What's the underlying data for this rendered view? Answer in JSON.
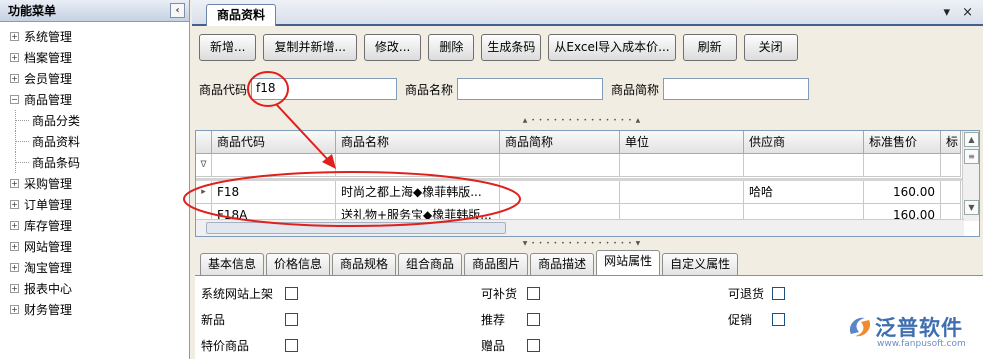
{
  "sidebar": {
    "title": "功能菜单",
    "collapse_icon": "chevron-left-icon",
    "items": [
      {
        "label": "系统管理",
        "expander": "+"
      },
      {
        "label": "档案管理",
        "expander": "+"
      },
      {
        "label": "会员管理",
        "expander": "+"
      },
      {
        "label": "商品管理",
        "expander": "−"
      },
      {
        "label": "采购管理",
        "expander": "+"
      },
      {
        "label": "订单管理",
        "expander": "+"
      },
      {
        "label": "库存管理",
        "expander": "+"
      },
      {
        "label": "网站管理",
        "expander": "+"
      },
      {
        "label": "淘宝管理",
        "expander": "+"
      },
      {
        "label": "报表中心",
        "expander": "+"
      },
      {
        "label": "财务管理",
        "expander": "+"
      }
    ],
    "children": [
      {
        "label": "商品分类"
      },
      {
        "label": "商品资料"
      },
      {
        "label": "商品条码"
      }
    ]
  },
  "tabbar": {
    "active_tab": "商品资料",
    "controls": "▾ ×"
  },
  "toolbar": {
    "new": "新增...",
    "copy_new": "复制并新增...",
    "edit": "修改...",
    "delete": "删除",
    "barcode": "生成条码",
    "import_excel": "从Excel导入成本价...",
    "refresh": "刷新",
    "close": "关闭"
  },
  "search": {
    "code_label": "商品代码",
    "code_value": "f18",
    "name_label": "商品名称",
    "name_value": "",
    "short_label": "商品简称",
    "short_value": ""
  },
  "grid": {
    "columns": [
      "商品代码",
      "商品名称",
      "商品简称",
      "单位",
      "供应商",
      "标准售价",
      "标"
    ],
    "filter_icon": "∇",
    "rows": [
      {
        "marker": "▸",
        "code": "F18",
        "name": "时尚之都上海◆橡菲韩版...",
        "short": "",
        "unit": "",
        "supplier": "哈哈",
        "price": "160.00"
      },
      {
        "marker": "",
        "code": "F18A",
        "name": "送礼物+服务宝◆橡菲韩版...",
        "short": "",
        "unit": "",
        "supplier": "",
        "price": "160.00"
      }
    ]
  },
  "bottom_tabs": [
    "基本信息",
    "价格信息",
    "商品规格",
    "组合商品",
    "商品图片",
    "商品描述",
    "网站属性",
    "自定义属性"
  ],
  "active_bottom_tab": "网站属性",
  "props": {
    "site_listed": "系统网站上架",
    "restockable": "可补货",
    "returnable": "可退货",
    "new_item": "新品",
    "recommended": "推荐",
    "promotion": "促销",
    "special_price": "特价商品",
    "gift": "赠品"
  },
  "watermark": {
    "brand": "泛普软件",
    "url": "www.fanpusoft.com"
  },
  "colors": {
    "annotation": "#e0201b",
    "accent": "#43618f"
  }
}
